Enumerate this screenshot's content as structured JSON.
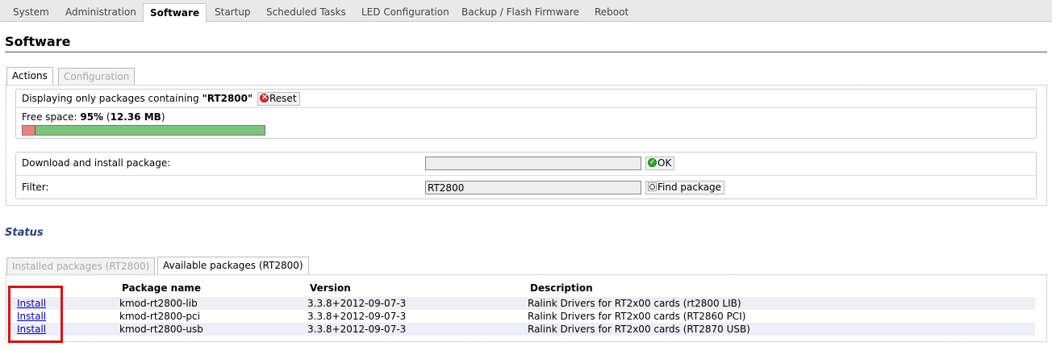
{
  "menu": {
    "tabs": [
      {
        "label": "System"
      },
      {
        "label": "Administration"
      },
      {
        "label": "Software"
      },
      {
        "label": "Startup"
      },
      {
        "label": "Scheduled Tasks"
      },
      {
        "label": "LED Configuration"
      },
      {
        "label": "Backup / Flash Firmware"
      },
      {
        "label": "Reboot"
      }
    ],
    "active": "Software"
  },
  "page": {
    "title": "Software"
  },
  "actions_tabs": [
    {
      "label": "Actions"
    },
    {
      "label": "Configuration"
    }
  ],
  "filter_info": {
    "prefix": "Displaying only packages containing ",
    "term": "\"RT2800\"",
    "reset_label": "Reset"
  },
  "free_space": {
    "label": "Free space: ",
    "percent": "95%",
    "open": " (",
    "size": "12.36 MB",
    "close": ")",
    "used_fraction": 0.05
  },
  "download": {
    "label": "Download and install package:",
    "value": "",
    "ok_label": "OK"
  },
  "filter": {
    "label": "Filter:",
    "value": "RT2800",
    "find_label": "Find package"
  },
  "status": {
    "heading": "Status"
  },
  "status_tabs": [
    {
      "label": "Installed packages (RT2800)"
    },
    {
      "label": "Available packages (RT2800)"
    }
  ],
  "table": {
    "headers": {
      "name": "Package name",
      "version": "Version",
      "description": "Description"
    },
    "rows": [
      {
        "action": "Install",
        "name": "kmod-rt2800-lib",
        "version": "3.3.8+2012-09-07-3",
        "description": "Ralink Drivers for RT2x00 cards (rt2800 LIB)"
      },
      {
        "action": "Install",
        "name": "kmod-rt2800-pci",
        "version": "3.3.8+2012-09-07-3",
        "description": "Ralink Drivers for RT2x00 cards (RT2860 PCI)"
      },
      {
        "action": "Install",
        "name": "kmod-rt2800-usb",
        "version": "3.3.8+2012-09-07-3",
        "description": "Ralink Drivers for RT2x00 cards (RT2870 USB)"
      }
    ]
  },
  "colors": {
    "highlight": "#e01010",
    "status_heading": "#2a3e7a",
    "link": "#0000cc"
  }
}
